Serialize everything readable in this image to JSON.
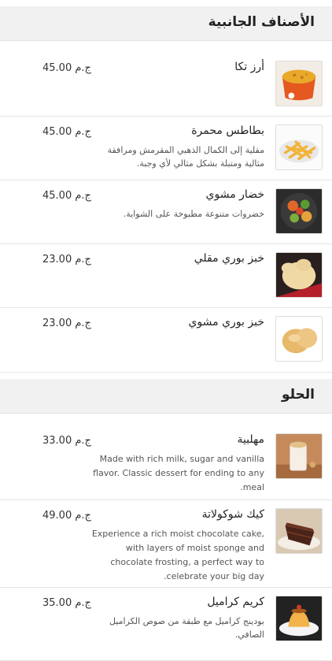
{
  "sections": [
    {
      "title": "الأصناف الجانبية",
      "items": [
        {
          "name": "أرز تكا",
          "description": "",
          "price": "45.00 ج.م",
          "icon": "rice-icon"
        },
        {
          "name": "بطاطس محمرة",
          "description": "مقلية إلى الكمال الذهبي المقرمش ومرافقة مثالية ومتبلة بشكل مثالي لأي وجبة.",
          "price": "45.00 ج.م",
          "icon": "fries-icon"
        },
        {
          "name": "خضار مشوي",
          "description": "خضروات متنوعة مطبوخة على الشواية.",
          "price": "45.00 ج.م",
          "icon": "grilled-vegetables-icon"
        },
        {
          "name": "خبز بوري مقلي",
          "description": "",
          "price": "23.00 ج.م",
          "icon": "fried-puri-icon"
        },
        {
          "name": "خبز بوري مشوي",
          "description": "",
          "price": "23.00 ج.م",
          "icon": "grilled-puri-icon"
        }
      ]
    },
    {
      "title": "الحلو",
      "items": [
        {
          "name": "مهلبية",
          "description": "Made with rich milk, sugar and vanilla flavor. Classic dessert for ending to any meal.",
          "price": "33.00 ج.م",
          "icon": "muhallabia-icon"
        },
        {
          "name": "كيك شوكولاتة",
          "description": "Experience a rich moist chocolate cake, with layers of moist sponge and chocolate frosting, a perfect way to celebrate your big day.",
          "price": "49.00 ج.م",
          "icon": "chocolate-cake-icon"
        },
        {
          "name": "كريم كراميل",
          "description": "بودينج كراميل مع طبقة من صوص الكراميل الصافي.",
          "price": "35.00 ج.م",
          "icon": "creme-caramel-icon"
        }
      ]
    }
  ]
}
